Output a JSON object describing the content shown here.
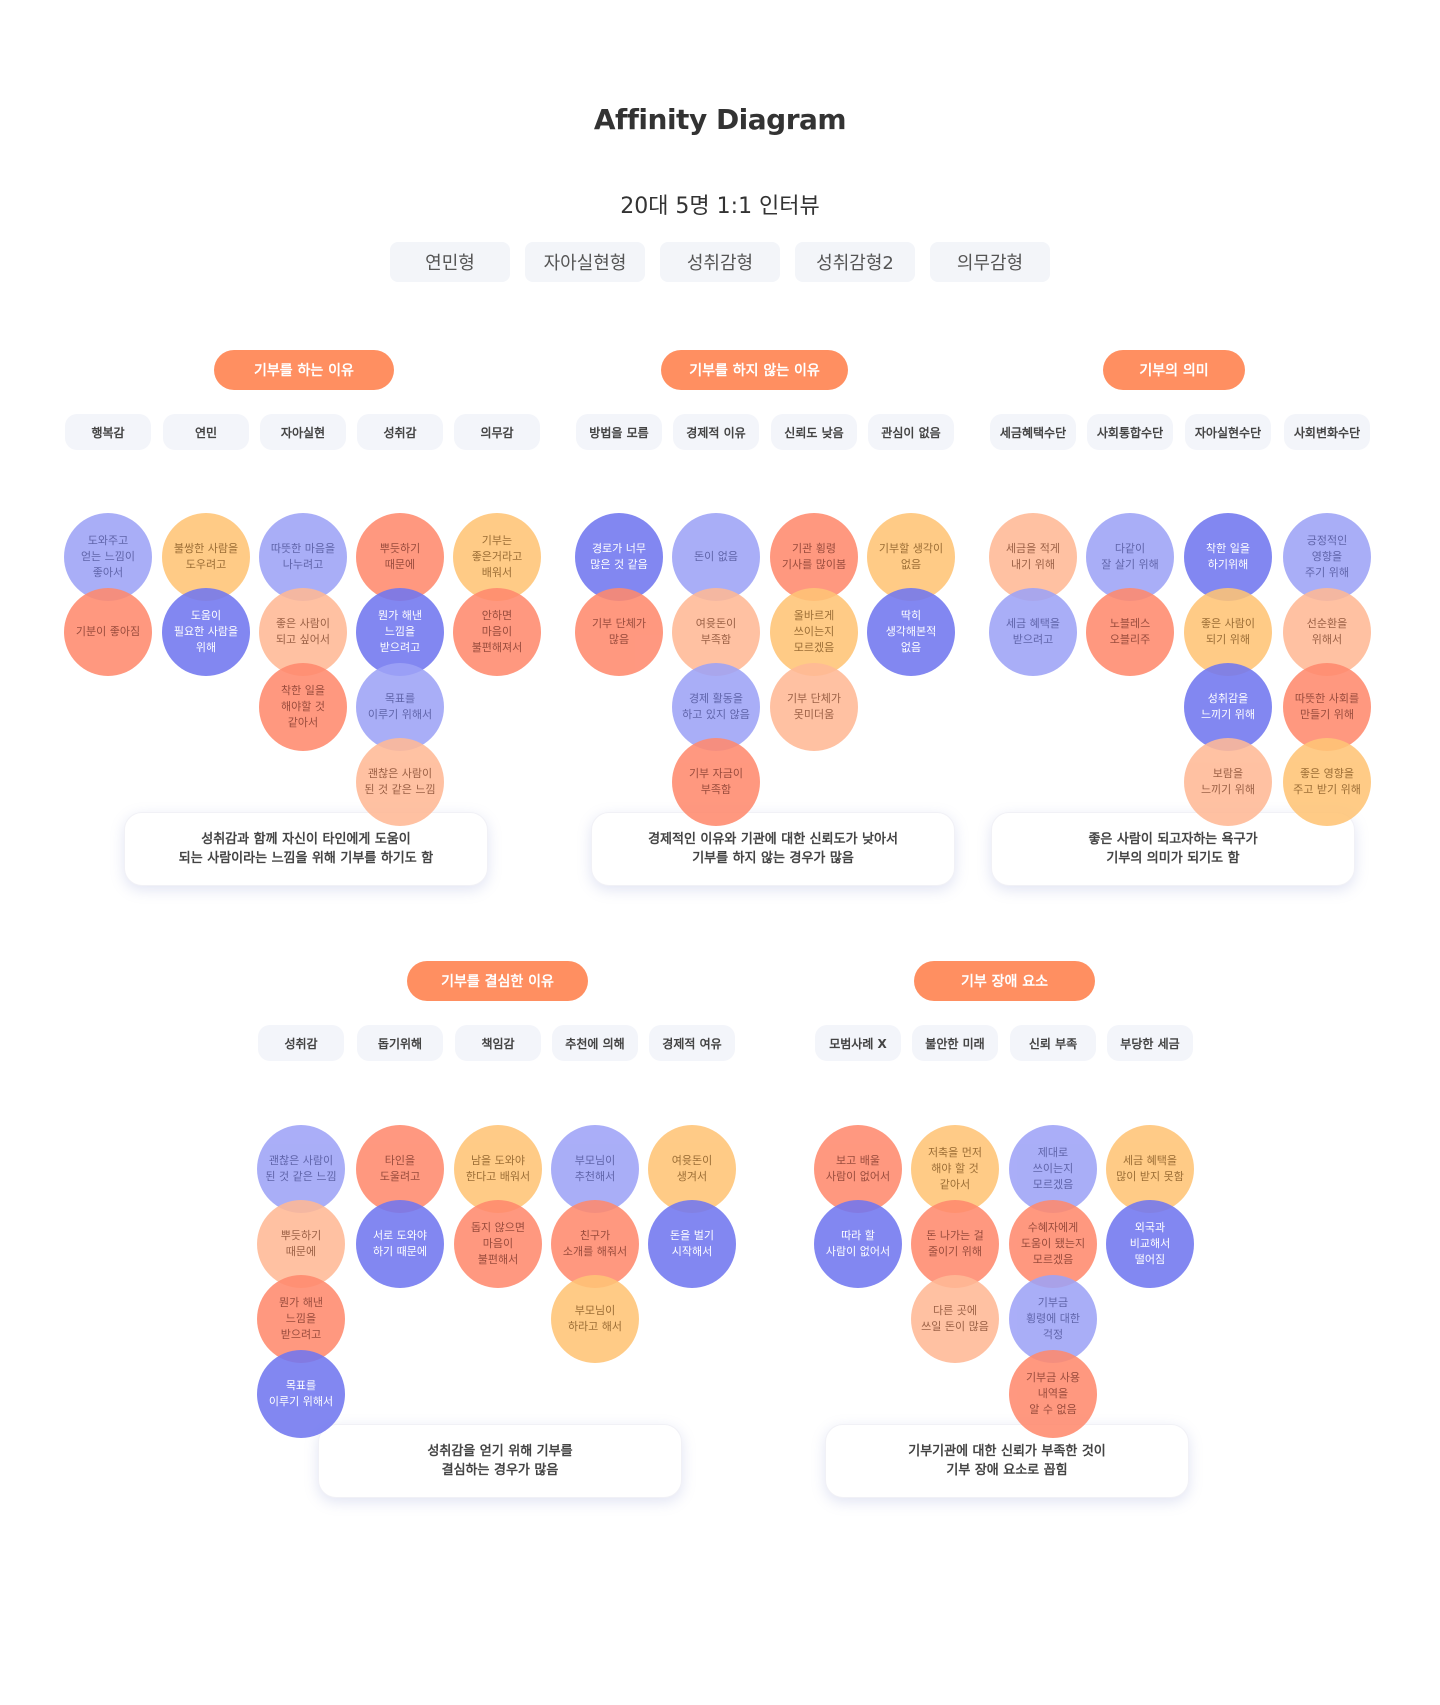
{
  "title": "Affinity Diagram",
  "subtitle": "20대 5명 1:1 인터뷰",
  "tags": [
    "연민형",
    "자아실현형",
    "성취감형",
    "성취감형2",
    "의무감형"
  ],
  "colors": {
    "header": "#ff8f61",
    "lavender": "#9ea3f7",
    "indigo": "#7177f0",
    "coral": "#ff8a6e",
    "yellow": "#ffc476",
    "peach": "#ffb996"
  },
  "sections": [
    {
      "header": "기부를 하는 이유",
      "columns": [
        {
          "label": "행복감",
          "notes": [
            {
              "text": "도와주고\n얻는 느낌이\n좋아서",
              "color": "lavender"
            },
            {
              "text": "기분이 좋아짐",
              "color": "coral"
            }
          ]
        },
        {
          "label": "연민",
          "notes": [
            {
              "text": "불쌍한 사람을\n도우려고",
              "color": "yellow"
            },
            {
              "text": "도움이\n필요한 사람을\n위해",
              "color": "indigo"
            }
          ]
        },
        {
          "label": "자아실현",
          "notes": [
            {
              "text": "따뜻한 마음을\n나누려고",
              "color": "lavender"
            },
            {
              "text": "좋은 사람이\n되고 싶어서",
              "color": "peach"
            },
            {
              "text": "착한 일을\n해야할 것\n같아서",
              "color": "coral"
            }
          ]
        },
        {
          "label": "성취감",
          "notes": [
            {
              "text": "뿌듯하기\n때문에",
              "color": "coral"
            },
            {
              "text": "뭔가 해낸\n느낌을\n받으려고",
              "color": "indigo"
            },
            {
              "text": "목표를\n이루기 위해서",
              "color": "lavender"
            },
            {
              "text": "괜찮은 사람이\n된 것 같은 느낌",
              "color": "peach"
            }
          ]
        },
        {
          "label": "의무감",
          "notes": [
            {
              "text": "기부는\n좋은거라고\n배워서",
              "color": "yellow"
            },
            {
              "text": "안하면\n마음이\n불편해져서",
              "color": "coral"
            }
          ]
        }
      ],
      "summary": "성취감과 함께 자신이 타인에게 도움이\n되는 사람이라는 느낌을 위해 기부를 하기도 함"
    },
    {
      "header": "기부를 하지 않는 이유",
      "columns": [
        {
          "label": "방법을 모름",
          "notes": [
            {
              "text": "경로가 너무\n많은 것 같음",
              "color": "indigo"
            },
            {
              "text": "기부 단체가\n많음",
              "color": "coral"
            }
          ]
        },
        {
          "label": "경제적 이유",
          "notes": [
            {
              "text": "돈이 없음",
              "color": "lavender"
            },
            {
              "text": "여윳돈이\n부족함",
              "color": "peach"
            },
            {
              "text": "경제 활동을\n하고 있지 않음",
              "color": "lavender"
            },
            {
              "text": "기부 자금이\n부족함",
              "color": "coral"
            }
          ]
        },
        {
          "label": "신뢰도 낮음",
          "notes": [
            {
              "text": "기관 횡령\n기사를 많이봄",
              "color": "coral"
            },
            {
              "text": "올바르게\n쓰이는지\n모르겠음",
              "color": "yellow"
            },
            {
              "text": "기부 단체가\n못미더움",
              "color": "peach"
            }
          ]
        },
        {
          "label": "관심이 없음",
          "notes": [
            {
              "text": "기부할 생각이\n없음",
              "color": "yellow"
            },
            {
              "text": "딱히\n생각해본적\n없음",
              "color": "indigo"
            }
          ]
        }
      ],
      "summary": "경제적인 이유와 기관에 대한 신뢰도가 낮아서\n기부를 하지 않는 경우가 많음"
    },
    {
      "header": "기부의 의미",
      "columns": [
        {
          "label": "세금혜택수단",
          "notes": [
            {
              "text": "세금을 적게\n내기 위해",
              "color": "peach"
            },
            {
              "text": "세금 혜택을\n받으려고",
              "color": "lavender"
            }
          ]
        },
        {
          "label": "사회통합수단",
          "notes": [
            {
              "text": "다같이\n잘 살기 위해",
              "color": "lavender"
            },
            {
              "text": "노블레스\n오블리주",
              "color": "coral"
            }
          ]
        },
        {
          "label": "자아실현수단",
          "notes": [
            {
              "text": "착한 일을\n하기위해",
              "color": "indigo"
            },
            {
              "text": "좋은 사람이\n되기 위해",
              "color": "yellow"
            },
            {
              "text": "성취감을\n느끼기 위해",
              "color": "indigo"
            },
            {
              "text": "보람을\n느끼기 위해",
              "color": "peach"
            }
          ]
        },
        {
          "label": "사회변화수단",
          "notes": [
            {
              "text": "긍정적인\n영향을\n주기 위해",
              "color": "lavender"
            },
            {
              "text": "선순환을\n위해서",
              "color": "peach"
            },
            {
              "text": "따뜻한 사회를\n만들기 위해",
              "color": "coral"
            },
            {
              "text": "좋은 영향을\n주고 받기 위해",
              "color": "yellow"
            }
          ]
        }
      ],
      "summary": "좋은 사람이 되고자하는 욕구가\n기부의 의미가 되기도 함"
    },
    {
      "header": "기부를 결심한 이유",
      "columns": [
        {
          "label": "성취감",
          "notes": [
            {
              "text": "괜찮은 사람이\n된 것 같은 느낌",
              "color": "lavender"
            },
            {
              "text": "뿌듯하기\n때문에",
              "color": "peach"
            },
            {
              "text": "뭔가 해낸\n느낌을\n받으려고",
              "color": "coral"
            },
            {
              "text": "목표를\n이루기 위해서",
              "color": "indigo"
            }
          ]
        },
        {
          "label": "돕기위해",
          "notes": [
            {
              "text": "타인을\n도울려고",
              "color": "coral"
            },
            {
              "text": "서로 도와야\n하기 때문에",
              "color": "indigo"
            }
          ]
        },
        {
          "label": "책임감",
          "notes": [
            {
              "text": "남을 도와야\n한다고 배워서",
              "color": "yellow"
            },
            {
              "text": "돕지 않으면\n마음이\n불편해서",
              "color": "coral"
            }
          ]
        },
        {
          "label": "추천에 의해",
          "notes": [
            {
              "text": "부모님이\n추천해서",
              "color": "lavender"
            },
            {
              "text": "친구가\n소개를 해줘서",
              "color": "coral"
            },
            {
              "text": "부모님이\n하라고 해서",
              "color": "yellow"
            }
          ]
        },
        {
          "label": "경제적 여유",
          "notes": [
            {
              "text": "여윳돈이\n생겨서",
              "color": "yellow"
            },
            {
              "text": "돈을 벌기\n시작해서",
              "color": "indigo"
            }
          ]
        }
      ],
      "summary": "성취감을 얻기 위해 기부를\n결심하는 경우가 많음"
    },
    {
      "header": "기부 장애 요소",
      "columns": [
        {
          "label": "모범사례 X",
          "notes": [
            {
              "text": "보고 배울\n사람이 없어서",
              "color": "coral"
            },
            {
              "text": "따라 할\n사람이 없어서",
              "color": "indigo"
            }
          ]
        },
        {
          "label": "불안한 미래",
          "notes": [
            {
              "text": "저축을 먼저\n해야 할 것\n같아서",
              "color": "yellow"
            },
            {
              "text": "돈 나가는 걸\n줄이기 위해",
              "color": "coral"
            },
            {
              "text": "다른 곳에\n쓰일 돈이 많음",
              "color": "peach"
            }
          ]
        },
        {
          "label": "신뢰 부족",
          "notes": [
            {
              "text": "제대로\n쓰이는지\n모르겠음",
              "color": "lavender"
            },
            {
              "text": "수혜자에게\n도움이 됐는지\n모르겠음",
              "color": "coral"
            },
            {
              "text": "기부금\n횡령에 대한\n걱정",
              "color": "lavender"
            },
            {
              "text": "기부금 사용\n내역을\n알 수 없음",
              "color": "coral"
            }
          ]
        },
        {
          "label": "부당한 세금",
          "notes": [
            {
              "text": "세금 혜택을\n많이 받지 못함",
              "color": "yellow"
            },
            {
              "text": "외국과\n비교해서\n떨어짐",
              "color": "indigo"
            }
          ]
        }
      ],
      "summary": "기부기관에 대한 신뢰가 부족한 것이\n기부 장애 요소로 꼽힘"
    }
  ]
}
